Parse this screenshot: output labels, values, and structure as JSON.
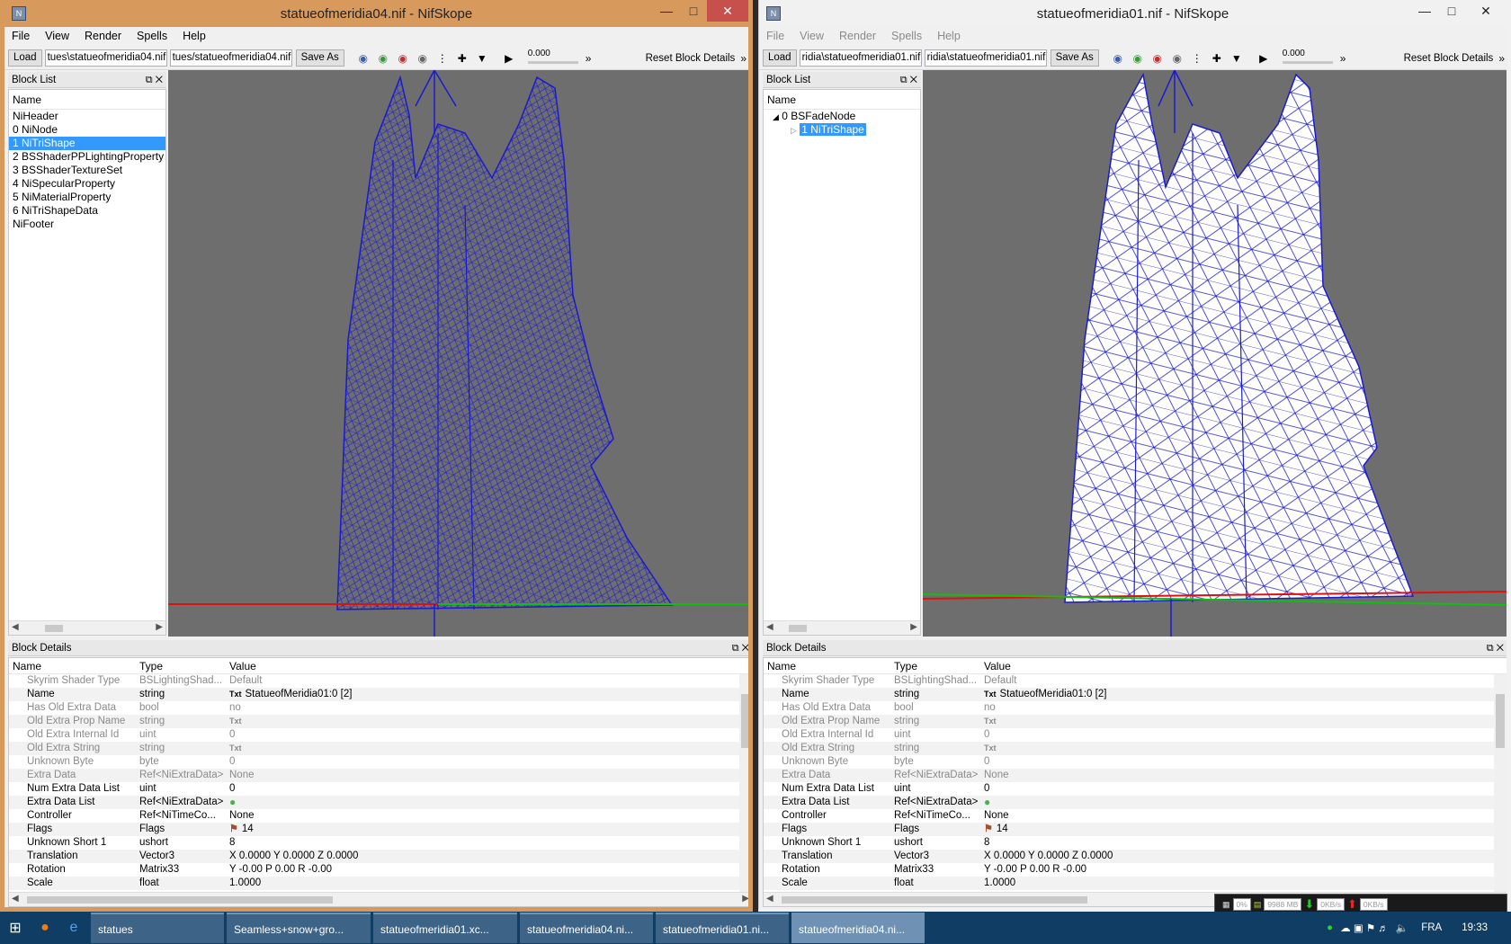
{
  "left_window": {
    "title": "statueofmeridia04.nif - NifSkope",
    "menu": [
      "File",
      "View",
      "Render",
      "Spells",
      "Help"
    ],
    "toolbar": {
      "load": "Load",
      "path1": "tues\\statueofmeridia04.nif",
      "path2": "tues/statueofmeridia04.nif",
      "save_as": "Save As",
      "time": "0.000",
      "reset": "Reset Block Details"
    },
    "block_list": {
      "title": "Block List",
      "header": "Name",
      "rows": [
        "NiHeader",
        "0 NiNode",
        "1 NiTriShape",
        "2 BSShaderPPLightingProperty",
        "3 BSShaderTextureSet",
        "4 NiSpecularProperty",
        "5 NiMaterialProperty",
        "6 NiTriShapeData",
        "NiFooter"
      ],
      "selected_index": 2
    },
    "details_title": "Block Details"
  },
  "right_window": {
    "title": "statueofmeridia01.nif - NifSkope",
    "menu": [
      "File",
      "View",
      "Render",
      "Spells",
      "Help"
    ],
    "toolbar": {
      "load": "Load",
      "path1": "ridia\\statueofmeridia01.nif",
      "path2": "ridia\\statueofmeridia01.nif",
      "save_as": "Save As",
      "time": "0.000",
      "reset": "Reset Block Details"
    },
    "block_list": {
      "title": "Block List",
      "header": "Name",
      "rows": [
        "0 BSFadeNode",
        "1 NiTriShape"
      ],
      "selected_index": 1
    },
    "details_title": "Block Details"
  },
  "details_columns": [
    "Name",
    "Type",
    "Value"
  ],
  "details_rows": [
    {
      "name": "Skyrim Shader Type",
      "type": "BSLightingShad...",
      "value": "Default",
      "dim": true
    },
    {
      "name": "Name",
      "type": "string",
      "value": "StatueofMeridia01:0 [2]",
      "dim": false,
      "badge": "Txt"
    },
    {
      "name": "Has Old Extra Data",
      "type": "bool",
      "value": "no",
      "dim": true
    },
    {
      "name": "Old Extra Prop Name",
      "type": "string",
      "value": "",
      "dim": true,
      "badge": "Txt"
    },
    {
      "name": "Old Extra Internal Id",
      "type": "uint",
      "value": "0",
      "dim": true
    },
    {
      "name": "Old Extra String",
      "type": "string",
      "value": "",
      "dim": true,
      "badge": "Txt"
    },
    {
      "name": "Unknown Byte",
      "type": "byte",
      "value": "0",
      "dim": true
    },
    {
      "name": "Extra Data",
      "type": "Ref<NiExtraData>",
      "value": "None",
      "dim": true
    },
    {
      "name": "Num Extra Data List",
      "type": "uint",
      "value": "0",
      "dim": false
    },
    {
      "name": "Extra Data List",
      "type": "Ref<NiExtraData>",
      "value": "",
      "dim": false,
      "badge": "&#9679;"
    },
    {
      "name": "Controller",
      "type": "Ref<NiTimeCo...",
      "value": "None",
      "dim": false
    },
    {
      "name": "Flags",
      "type": "Flags",
      "value": "14",
      "dim": false,
      "badge": "&#9873;"
    },
    {
      "name": "Unknown Short 1",
      "type": "ushort",
      "value": "8",
      "dim": false
    },
    {
      "name": "Translation",
      "type": "Vector3",
      "value": "X 0.0000 Y 0.0000 Z 0.0000",
      "dim": false
    },
    {
      "name": "Rotation",
      "type": "Matrix33",
      "value": "Y -0.00 P 0.00 R -0.00",
      "dim": false
    },
    {
      "name": "Scale",
      "type": "float",
      "value": "1.0000",
      "dim": false
    }
  ],
  "taskbar": {
    "items": [
      "statues",
      "Seamless+snow+gro...",
      "statueofmeridia01.xc...",
      "statueofmeridia04.ni...",
      "statueofmeridia01.ni...",
      "statueofmeridia04.ni..."
    ],
    "active_index": 5,
    "lang": "FRA",
    "time": "19:33"
  },
  "net_panel": {
    "cpu": "0%",
    "mem": "9988 MB",
    "down": "0KB/s",
    "up": "0KB/s"
  }
}
